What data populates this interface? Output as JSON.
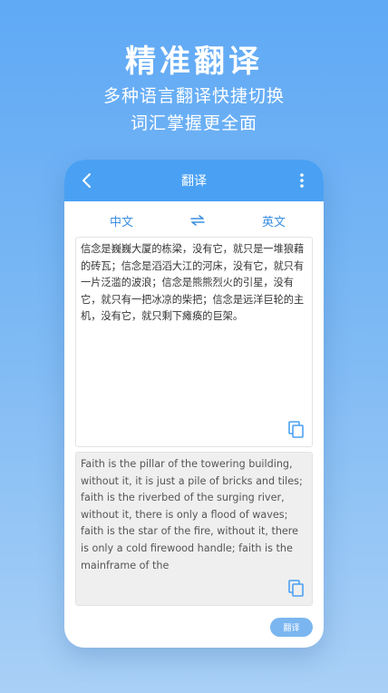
{
  "hero": {
    "title": "精准翻译",
    "subtitle_line1": "多种语言翻译快捷切换",
    "subtitle_line2": "词汇掌握更全面"
  },
  "appbar": {
    "title": "翻译",
    "back_icon": "chevron-left-icon",
    "menu_icon": "more-vertical-icon"
  },
  "languages": {
    "source": "中文",
    "target": "英文",
    "swap_icon": "swap-arrows-icon"
  },
  "source_text": "信念是巍巍大厦的栋梁，没有它，就只是一堆狼藉的砖瓦；信念是滔滔大江的河床，没有它，就只有一片泛滥的波浪；信念是熊熊烈火的引星，没有它，就只有一把冰凉的柴把；信念是远洋巨轮的主机，没有它，就只剩下瘫痪的巨架。",
  "translated_text": "Faith is the pillar of the towering building, without it, it is just a pile of bricks and tiles; faith is the riverbed of the surging river, without it, there is only a flood of waves; faith is the star of the fire, without it, there is only a cold firewood handle; faith is the mainframe of the",
  "copy_icon": "copy-icon",
  "translate_button": "翻译",
  "colors": {
    "accent": "#4aa1f3",
    "button": "#7bb6f0",
    "language_text": "#3c8fe0"
  }
}
